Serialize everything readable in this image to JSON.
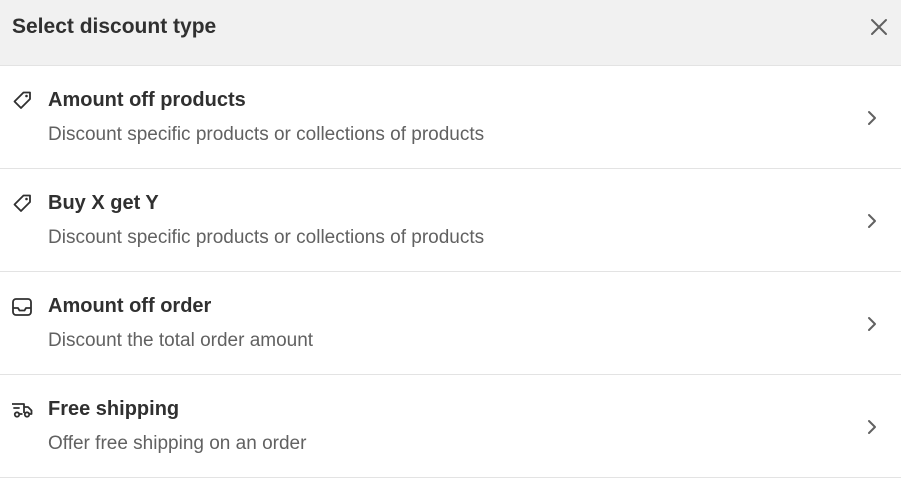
{
  "modal": {
    "title": "Select discount type",
    "close_icon": "close-icon"
  },
  "options": [
    {
      "icon": "tag-icon",
      "title": "Amount off products",
      "description": "Discount specific products or collections of products"
    },
    {
      "icon": "tag-icon",
      "title": "Buy X get Y",
      "description": "Discount specific products or collections of products"
    },
    {
      "icon": "order-tray-icon",
      "title": "Amount off order",
      "description": "Discount the total order amount"
    },
    {
      "icon": "delivery-truck-icon",
      "title": "Free shipping",
      "description": "Offer free shipping on an order"
    }
  ],
  "colors": {
    "header_bg": "#f1f1f1",
    "text_primary": "#303030",
    "text_secondary": "#616161",
    "divider": "#e3e3e3"
  }
}
